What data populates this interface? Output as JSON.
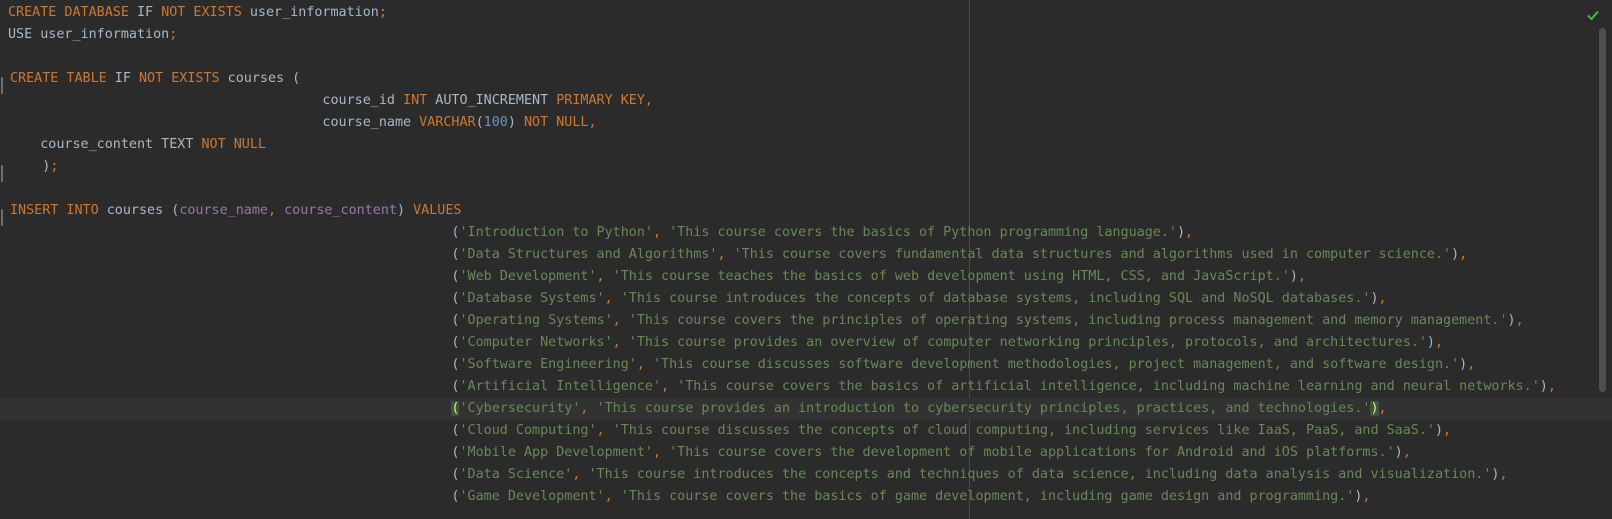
{
  "editor": {
    "status_icon": "check-icon",
    "colors": {
      "background": "#2b2b2b",
      "keyword": "#cc7832",
      "string": "#6a8759",
      "number": "#6897bb",
      "column": "#9876aa",
      "identifier": "#a9b7c6",
      "status_ok": "#4caf50"
    },
    "lines": [
      [
        {
          "t": "CREATE DATABASE",
          "c": "kw"
        },
        {
          "t": " IF ",
          "c": "id"
        },
        {
          "t": "NOT EXISTS",
          "c": "kw"
        },
        {
          "t": " user_information",
          "c": "id"
        },
        {
          "t": ";",
          "c": "kw"
        }
      ],
      [
        {
          "t": "USE user_information",
          "c": "id"
        },
        {
          "t": ";",
          "c": "kw"
        }
      ],
      [],
      [
        {
          "t": "CREATE TABLE",
          "c": "kw"
        },
        {
          "t": " IF ",
          "c": "id"
        },
        {
          "t": "NOT EXISTS",
          "c": "kw"
        },
        {
          "t": " courses (",
          "c": "id"
        }
      ],
      [
        {
          "t": "                                       course_id ",
          "c": "id"
        },
        {
          "t": "INT",
          "c": "kw"
        },
        {
          "t": " AUTO_INCREMENT ",
          "c": "id"
        },
        {
          "t": "PRIMARY KEY",
          "c": "kw"
        },
        {
          "t": ",",
          "c": "kw"
        }
      ],
      [
        {
          "t": "                                       course_name ",
          "c": "id"
        },
        {
          "t": "VARCHAR",
          "c": "kw"
        },
        {
          "t": "(",
          "c": "id"
        },
        {
          "t": "100",
          "c": "num"
        },
        {
          "t": ") ",
          "c": "id"
        },
        {
          "t": "NOT NULL",
          "c": "kw"
        },
        {
          "t": ",",
          "c": "kw"
        }
      ],
      [
        {
          "t": "    course_content TEXT ",
          "c": "id"
        },
        {
          "t": "NOT NULL",
          "c": "kw"
        }
      ],
      [
        {
          "t": "    )",
          "c": "id"
        },
        {
          "t": ";",
          "c": "kw"
        }
      ],
      [],
      [
        {
          "t": "INSERT INTO",
          "c": "kw"
        },
        {
          "t": " courses (",
          "c": "id"
        },
        {
          "t": "course_name",
          "c": "col"
        },
        {
          "t": ", ",
          "c": "kw"
        },
        {
          "t": "course_content",
          "c": "col"
        },
        {
          "t": ") ",
          "c": "id"
        },
        {
          "t": "VALUES",
          "c": "kw"
        }
      ],
      [
        {
          "t": "                                                       (",
          "c": "id"
        },
        {
          "t": "'Introduction to Python'",
          "c": "str"
        },
        {
          "t": ", ",
          "c": "kw"
        },
        {
          "t": "'This course covers the basics of Python programming language.'",
          "c": "str"
        },
        {
          "t": ")",
          "c": "id"
        },
        {
          "t": ",",
          "c": "kw"
        }
      ],
      [
        {
          "t": "                                                       (",
          "c": "id"
        },
        {
          "t": "'Data Structures and Algorithms'",
          "c": "str"
        },
        {
          "t": ", ",
          "c": "kw"
        },
        {
          "t": "'This course covers fundamental data structures and algorithms used in computer science.'",
          "c": "str"
        },
        {
          "t": ")",
          "c": "id"
        },
        {
          "t": ",",
          "c": "kw"
        }
      ],
      [
        {
          "t": "                                                       (",
          "c": "id"
        },
        {
          "t": "'Web Development'",
          "c": "str"
        },
        {
          "t": ", ",
          "c": "kw"
        },
        {
          "t": "'This course teaches the basics of web development using HTML, CSS, and JavaScript.'",
          "c": "str"
        },
        {
          "t": ")",
          "c": "id"
        },
        {
          "t": ",",
          "c": "kw"
        }
      ],
      [
        {
          "t": "                                                       (",
          "c": "id"
        },
        {
          "t": "'Database Systems'",
          "c": "str"
        },
        {
          "t": ", ",
          "c": "kw"
        },
        {
          "t": "'This course introduces the concepts of database systems, including SQL and NoSQL databases.'",
          "c": "str"
        },
        {
          "t": ")",
          "c": "id"
        },
        {
          "t": ",",
          "c": "kw"
        }
      ],
      [
        {
          "t": "                                                       (",
          "c": "id"
        },
        {
          "t": "'Operating Systems'",
          "c": "str"
        },
        {
          "t": ", ",
          "c": "kw"
        },
        {
          "t": "'This course covers the principles of operating systems, including process management and memory management.'",
          "c": "str"
        },
        {
          "t": ")",
          "c": "id"
        },
        {
          "t": ",",
          "c": "kw"
        }
      ],
      [
        {
          "t": "                                                       (",
          "c": "id"
        },
        {
          "t": "'Computer Networks'",
          "c": "str"
        },
        {
          "t": ", ",
          "c": "kw"
        },
        {
          "t": "'This course provides an overview of computer networking principles, protocols, and architectures.'",
          "c": "str"
        },
        {
          "t": ")",
          "c": "id"
        },
        {
          "t": ",",
          "c": "kw"
        }
      ],
      [
        {
          "t": "                                                       (",
          "c": "id"
        },
        {
          "t": "'Software Engineering'",
          "c": "str"
        },
        {
          "t": ", ",
          "c": "kw"
        },
        {
          "t": "'This course discusses software development methodologies, project management, and software design.'",
          "c": "str"
        },
        {
          "t": ")",
          "c": "id"
        },
        {
          "t": ",",
          "c": "kw"
        }
      ],
      [
        {
          "t": "                                                       (",
          "c": "id"
        },
        {
          "t": "'Artificial Intelligence'",
          "c": "str"
        },
        {
          "t": ", ",
          "c": "kw"
        },
        {
          "t": "'This course covers the basics of artificial intelligence, including machine learning and neural networks.'",
          "c": "str"
        },
        {
          "t": ")",
          "c": "id"
        },
        {
          "t": ",",
          "c": "kw"
        }
      ],
      [
        {
          "t": "                                                       ",
          "c": "id"
        },
        {
          "t": "(",
          "c": "hl"
        },
        {
          "t": "'Cybersecurity'",
          "c": "str"
        },
        {
          "t": ", ",
          "c": "kw"
        },
        {
          "t": "'This course provides an introduction to cybersecurity principles, practices, and technologies.'",
          "c": "str"
        },
        {
          "t": ")",
          "c": "hl"
        },
        {
          "t": ",",
          "c": "kw"
        }
      ],
      [
        {
          "t": "                                                       (",
          "c": "id"
        },
        {
          "t": "'Cloud Computing'",
          "c": "str"
        },
        {
          "t": ", ",
          "c": "kw"
        },
        {
          "t": "'This course discusses the concepts of cloud computing, including services like IaaS, PaaS, and SaaS.'",
          "c": "str"
        },
        {
          "t": ")",
          "c": "id"
        },
        {
          "t": ",",
          "c": "kw"
        }
      ],
      [
        {
          "t": "                                                       (",
          "c": "id"
        },
        {
          "t": "'Mobile App Development'",
          "c": "str"
        },
        {
          "t": ", ",
          "c": "kw"
        },
        {
          "t": "'This course covers the development of mobile applications for Android and iOS platforms.'",
          "c": "str"
        },
        {
          "t": ")",
          "c": "id"
        },
        {
          "t": ",",
          "c": "kw"
        }
      ],
      [
        {
          "t": "                                                       (",
          "c": "id"
        },
        {
          "t": "'Data Science'",
          "c": "str"
        },
        {
          "t": ", ",
          "c": "kw"
        },
        {
          "t": "'This course introduces the concepts and techniques of data science, including data analysis and visualization.'",
          "c": "str"
        },
        {
          "t": ")",
          "c": "id"
        },
        {
          "t": ",",
          "c": "kw"
        }
      ],
      [
        {
          "t": "                                                       (",
          "c": "id"
        },
        {
          "t": "'Game Development'",
          "c": "str"
        },
        {
          "t": ", ",
          "c": "kw"
        },
        {
          "t": "'This course covers the basics of game development, including game design and programming.'",
          "c": "str"
        },
        {
          "t": ")",
          "c": "id"
        },
        {
          "t": ",",
          "c": "kw"
        }
      ]
    ]
  }
}
